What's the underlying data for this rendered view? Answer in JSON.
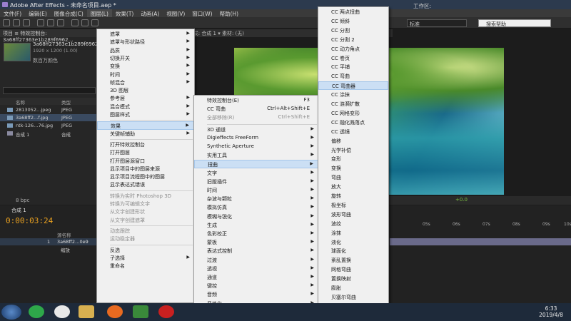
{
  "window": {
    "title": "Adobe After Effects - 未命名项目.aep *"
  },
  "menubar": [
    "文件(F)",
    "编辑(E)",
    "图像合成(C)",
    "图层(L)",
    "效果(T)",
    "动画(A)",
    "视图(V)",
    "窗口(W)",
    "帮助(H)"
  ],
  "toolbar": {
    "workspace_label": "工作区:",
    "workspace_value": "标准",
    "help_placeholder": "搜索帮助"
  },
  "project_panel": {
    "tabs": "项目 ≡    特效控制台: 3a68ff27363e1b289f6962…",
    "selected_file": "3a68ff27363e1b289f69628…",
    "selected_size": "1920 x 1200 (1.00)",
    "selected_colors": "数百万颜色",
    "columns": {
      "name": "名称",
      "type": "类型"
    },
    "items": [
      {
        "name": "2813052…jpeg",
        "type": "JPEG"
      },
      {
        "name": "3a68ff2…f.jpg",
        "type": "JPEG"
      },
      {
        "name": "ntk-126…76.jpg",
        "type": "JPEG"
      },
      {
        "name": "合成 1",
        "type": "合成"
      }
    ],
    "bpc": "8 bpc"
  },
  "viewer": {
    "tabs": "▸ 合成: 合成 1 ▾    素材: (无)",
    "zoom": "+0.0"
  },
  "timeline": {
    "tab": "合成 1",
    "timecode": "0:00:03:24",
    "layer_header": "源名称",
    "layer_num": "1",
    "layer_name": "3a68ff2…0e9",
    "sub_prop": "缩放",
    "ruler": [
      "05s",
      "06s",
      "07s",
      "08s",
      "09s",
      "10s"
    ]
  },
  "main_menu": [
    {
      "label": "遮罩",
      "arrow": true
    },
    {
      "label": "遮罩与形状路径",
      "arrow": true
    },
    {
      "label": "品质",
      "arrow": true
    },
    {
      "label": "切换开关",
      "arrow": true
    },
    {
      "label": "变换",
      "arrow": true
    },
    {
      "label": "时间",
      "arrow": true
    },
    {
      "label": "帧混合",
      "arrow": true
    },
    {
      "label": "3D 图层"
    },
    {
      "label": "参考层",
      "arrow": true
    },
    {
      "label": "混合模式",
      "arrow": true
    },
    {
      "label": "图层样式",
      "arrow": true
    },
    {
      "sep": true
    },
    {
      "label": "效果",
      "arrow": true,
      "hl": true
    },
    {
      "label": "关键帧辅助",
      "arrow": true
    },
    {
      "sep": true
    },
    {
      "label": "打开特效控制台"
    },
    {
      "label": "打开图层"
    },
    {
      "label": "打开图层源窗口"
    },
    {
      "label": "显示项目中的图层来源"
    },
    {
      "label": "显示项目流程图中的图层"
    },
    {
      "label": "显示表达式错误"
    },
    {
      "sep": true
    },
    {
      "label": "转换为实时 Photoshop 3D",
      "dis": true
    },
    {
      "label": "转换为可编辑文字",
      "dis": true
    },
    {
      "label": "从文字创建形状",
      "dis": true
    },
    {
      "label": "从文字创建遮罩",
      "dis": true
    },
    {
      "sep": true
    },
    {
      "label": "动态跟踪",
      "dis": true
    },
    {
      "label": "运动稳定器",
      "dis": true
    },
    {
      "sep": true
    },
    {
      "label": "反选"
    },
    {
      "label": "子选择",
      "arrow": true
    },
    {
      "label": "重命名"
    }
  ],
  "effects_menu": [
    {
      "label": "特效控制台(E)",
      "sc": "F3"
    },
    {
      "label": "CC 弯曲",
      "sc": "Ctrl+Alt+Shift+E"
    },
    {
      "label": "全部移除(R)",
      "sc": "Ctrl+Shift+E",
      "dis": true
    },
    {
      "sep": true
    },
    {
      "label": "3D 通道",
      "arrow": true
    },
    {
      "label": "Digieffects FreeForm",
      "arrow": true
    },
    {
      "label": "Synthetic Aperture",
      "arrow": true
    },
    {
      "label": "实用工具",
      "arrow": true
    },
    {
      "label": "扭曲",
      "arrow": true,
      "hl": true
    },
    {
      "label": "文字",
      "arrow": true
    },
    {
      "label": "旧版插件",
      "arrow": true
    },
    {
      "label": "时间",
      "arrow": true
    },
    {
      "label": "杂波与颗粒",
      "arrow": true
    },
    {
      "label": "模拟仿真",
      "arrow": true
    },
    {
      "label": "模糊与锐化",
      "arrow": true
    },
    {
      "label": "生成",
      "arrow": true
    },
    {
      "label": "色彩校正",
      "arrow": true
    },
    {
      "label": "蒙板",
      "arrow": true
    },
    {
      "label": "表达式控制",
      "arrow": true
    },
    {
      "label": "过渡",
      "arrow": true
    },
    {
      "label": "透视",
      "arrow": true
    },
    {
      "label": "通道",
      "arrow": true
    },
    {
      "label": "键控",
      "arrow": true
    },
    {
      "label": "音频",
      "arrow": true
    },
    {
      "label": "风格化",
      "arrow": true
    }
  ],
  "distort_menu": [
    {
      "label": "CC 两点扭曲"
    },
    {
      "label": "CC 倾斜"
    },
    {
      "label": "CC 分割"
    },
    {
      "label": "CC 分割 2"
    },
    {
      "label": "CC 动力角点"
    },
    {
      "label": "CC 卷页"
    },
    {
      "label": "CC 平铺"
    },
    {
      "label": "CC 弯曲"
    },
    {
      "label": "CC 弯曲器",
      "hl": true
    },
    {
      "label": "CC 涂抹"
    },
    {
      "label": "CC 涟漪扩散"
    },
    {
      "label": "CC 网格变形"
    },
    {
      "label": "CC 融化溅落点"
    },
    {
      "label": "CC 透镜"
    },
    {
      "label": "偏移"
    },
    {
      "label": "光学补偿"
    },
    {
      "label": "变形"
    },
    {
      "label": "变换"
    },
    {
      "label": "弯曲"
    },
    {
      "label": "放大"
    },
    {
      "label": "旋转"
    },
    {
      "label": "极坐标"
    },
    {
      "label": "波形弯曲"
    },
    {
      "label": "波纹"
    },
    {
      "label": "涂抹"
    },
    {
      "label": "液化"
    },
    {
      "label": "球面化"
    },
    {
      "label": "紊乱置换"
    },
    {
      "label": "网格弯曲"
    },
    {
      "label": "置换映射"
    },
    {
      "label": "膨胀"
    },
    {
      "label": "贝塞尔弯曲"
    },
    {
      "label": "边角固定"
    },
    {
      "label": "镜像"
    }
  ],
  "taskbar": {
    "time": "6:33",
    "date": "2019/4/8"
  }
}
